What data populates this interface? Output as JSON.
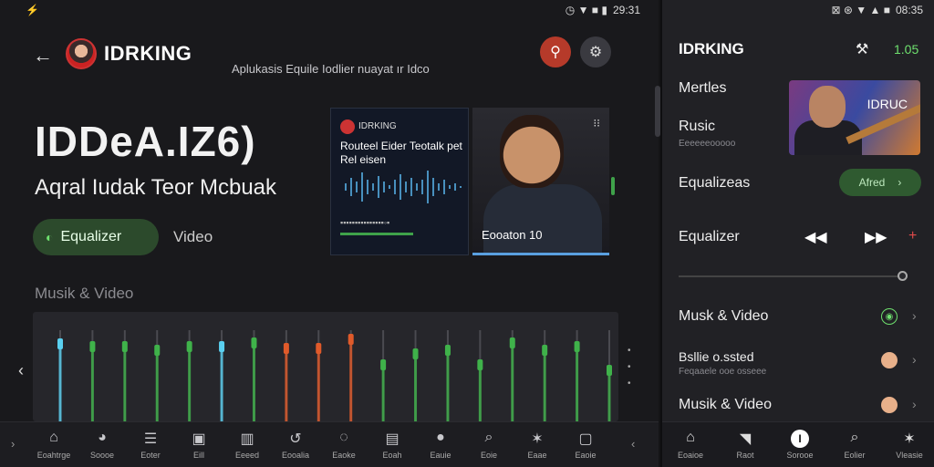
{
  "left": {
    "status": {
      "left_icons": "⚡",
      "time": "29:31",
      "icons": "◷ ▼ ■ ▮"
    },
    "header": {
      "brand": "IDRKING",
      "subtitle": "Aplukasis Equile Iodlier nuayat ır Idco"
    },
    "hero": {
      "title": "IDDeA.IZ6)",
      "subtitle": "Aqral Iudak Teor Mcbuak",
      "pill_label": "Equalizer",
      "tab_video": "Video"
    },
    "card1": {
      "brand": "IDRKING",
      "title": "Routeel Eider Teotalk pet Rel eisen",
      "meta": "▪▪▪▪▪▪▪▪▪▪▪▪▪▪▪◦▪"
    },
    "card2": {
      "caption": "Eooaton 10"
    },
    "section_label": "Musik & Video",
    "equalizer": {
      "bars": [
        {
          "level": 0.65,
          "accent": "#5ad0f0"
        },
        {
          "level": 0.62,
          "accent": "#3fb24a"
        },
        {
          "level": 0.62,
          "accent": "#3fb24a"
        },
        {
          "level": 0.58,
          "accent": "#3fb24a"
        },
        {
          "level": 0.62,
          "accent": "#3fb24a"
        },
        {
          "level": 0.62,
          "accent": "#5ad0f0"
        },
        {
          "level": 0.66,
          "accent": "#3fb24a"
        },
        {
          "level": 0.6,
          "accent": "#e05a2a"
        },
        {
          "level": 0.6,
          "accent": "#e05a2a"
        },
        {
          "level": 0.7,
          "accent": "#e05a2a"
        },
        {
          "level": 0.42,
          "accent": "#3fb24a"
        },
        {
          "level": 0.54,
          "accent": "#3fb24a"
        },
        {
          "level": 0.58,
          "accent": "#3fb24a"
        },
        {
          "level": 0.42,
          "accent": "#3fb24a"
        },
        {
          "level": 0.66,
          "accent": "#3fb24a"
        },
        {
          "level": 0.58,
          "accent": "#3fb24a"
        },
        {
          "level": 0.62,
          "accent": "#3fb24a"
        },
        {
          "level": 0.36,
          "accent": "#3fb24a"
        }
      ]
    },
    "bottom_nav": [
      {
        "icon": "⌂",
        "label": "Eoahtrge"
      },
      {
        "icon": "◕",
        "label": "Soooe"
      },
      {
        "icon": "☰",
        "label": "Eoter"
      },
      {
        "icon": "▣",
        "label": "Eill"
      },
      {
        "icon": "▥",
        "label": "Eeeed"
      },
      {
        "icon": "↺",
        "label": "Eooalia"
      },
      {
        "icon": "◌",
        "label": "Eaoke"
      },
      {
        "icon": "▤",
        "label": "Eoah"
      },
      {
        "icon": "●",
        "label": "Eauie"
      },
      {
        "icon": "⌕",
        "label": "Eoie"
      },
      {
        "icon": "✶",
        "label": "Eaae"
      },
      {
        "icon": "▢",
        "label": "Eaoie"
      }
    ]
  },
  "right": {
    "status": {
      "icons": "⊠ ⊛ ▼ ▲ ■",
      "time": "08:35"
    },
    "header": {
      "title": "IDRKING",
      "count": "1.05"
    },
    "rows": {
      "row1": "Mertles",
      "row2": "Rusic",
      "row2_sub": "Eeeeeeooooo",
      "thumb_title": "IDRUC",
      "row3": "Equalizeas",
      "row3_pill": "Afred",
      "row4": "Equalizer",
      "row5": "Musk & Video",
      "row6": "Bsllie o.ssted",
      "row6_sub": "Feqaaele ooe osseee",
      "row7": "Musik & Video"
    },
    "bottom_nav": [
      {
        "icon": "⌂",
        "label": "Eoaioe"
      },
      {
        "icon": "◥",
        "label": "Raot"
      },
      {
        "icon": "I",
        "label": "Sorooe"
      },
      {
        "icon": "⌕",
        "label": "Eolier"
      },
      {
        "icon": "✶",
        "label": "Vleasie"
      }
    ]
  },
  "colors": {
    "accent_green": "#3fa24a",
    "accent_red": "#b63a2a",
    "background": "#19191c"
  }
}
